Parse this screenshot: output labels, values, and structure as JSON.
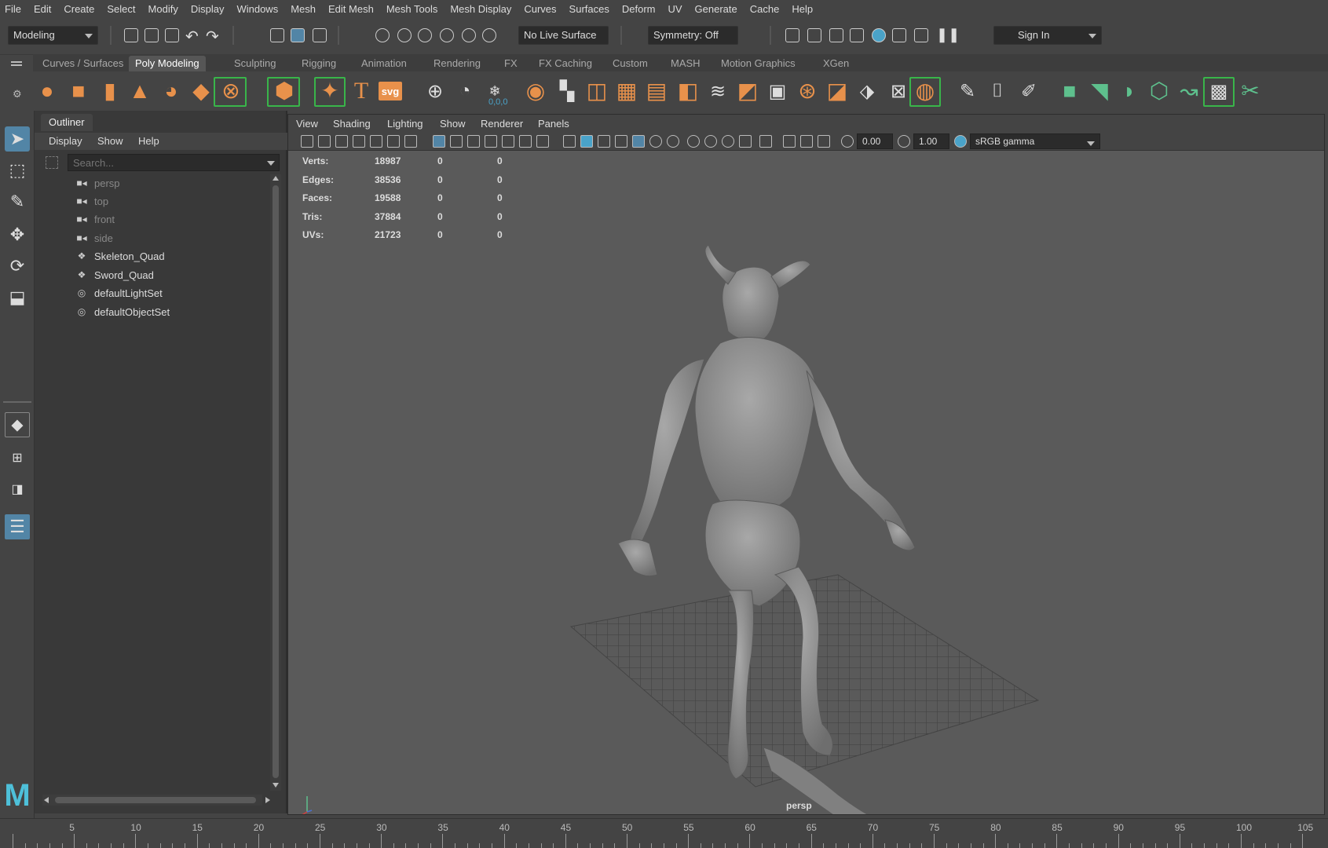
{
  "menubar": [
    "File",
    "Edit",
    "Create",
    "Select",
    "Modify",
    "Display",
    "Windows",
    "Mesh",
    "Edit Mesh",
    "Mesh Tools",
    "Mesh Display",
    "Curves",
    "Surfaces",
    "Deform",
    "UV",
    "Generate",
    "Cache",
    "Help"
  ],
  "status": {
    "mode": "Modeling",
    "live_surface": "No Live Surface",
    "symmetry": "Symmetry: Off",
    "sign_in": "Sign In"
  },
  "shelf_tabs": [
    "Curves / Surfaces",
    "Poly Modeling",
    "Sculpting",
    "Rigging",
    "Animation",
    "Rendering",
    "FX",
    "FX Caching",
    "Custom",
    "MASH",
    "Motion Graphics",
    "XGen"
  ],
  "shelf_active": "Poly Modeling",
  "shelf": {
    "text_tool": "T",
    "svg_tool": "svg",
    "coords": "0,0,0"
  },
  "outliner": {
    "title": "Outliner",
    "menu": [
      "Display",
      "Show",
      "Help"
    ],
    "search_placeholder": "Search...",
    "items": [
      {
        "label": "persp",
        "icon": "camera-icon"
      },
      {
        "label": "top",
        "icon": "camera-icon"
      },
      {
        "label": "front",
        "icon": "camera-icon"
      },
      {
        "label": "side",
        "icon": "camera-icon"
      },
      {
        "label": "Skeleton_Quad",
        "icon": "mesh-icon"
      },
      {
        "label": "Sword_Quad",
        "icon": "mesh-icon"
      },
      {
        "label": "defaultLightSet",
        "icon": "set-icon"
      },
      {
        "label": "defaultObjectSet",
        "icon": "set-icon"
      }
    ]
  },
  "viewport": {
    "menu": [
      "View",
      "Shading",
      "Lighting",
      "Show",
      "Renderer",
      "Panels"
    ],
    "exposure": "0.00",
    "gamma": "1.00",
    "colorspace": "sRGB gamma",
    "camera": "persp",
    "hud": [
      {
        "label": "Verts:",
        "v1": "18987",
        "v2": "0",
        "v3": "0"
      },
      {
        "label": "Edges:",
        "v1": "38536",
        "v2": "0",
        "v3": "0"
      },
      {
        "label": "Faces:",
        "v1": "19588",
        "v2": "0",
        "v3": "0"
      },
      {
        "label": "Tris:",
        "v1": "37884",
        "v2": "0",
        "v3": "0"
      },
      {
        "label": "UVs:",
        "v1": "21723",
        "v2": "0",
        "v3": "0"
      }
    ]
  },
  "timeline": {
    "ticks": [
      "5",
      "10",
      "15",
      "20",
      "25",
      "30",
      "35",
      "40",
      "45",
      "50",
      "55",
      "60",
      "65",
      "70",
      "75",
      "80",
      "85",
      "90",
      "95",
      "100",
      "105"
    ]
  },
  "colors": {
    "accent_orange": "#e8914b",
    "accent_teal": "#5ec08d",
    "active_tab": "#565656",
    "selected_tool": "#5285a6"
  }
}
